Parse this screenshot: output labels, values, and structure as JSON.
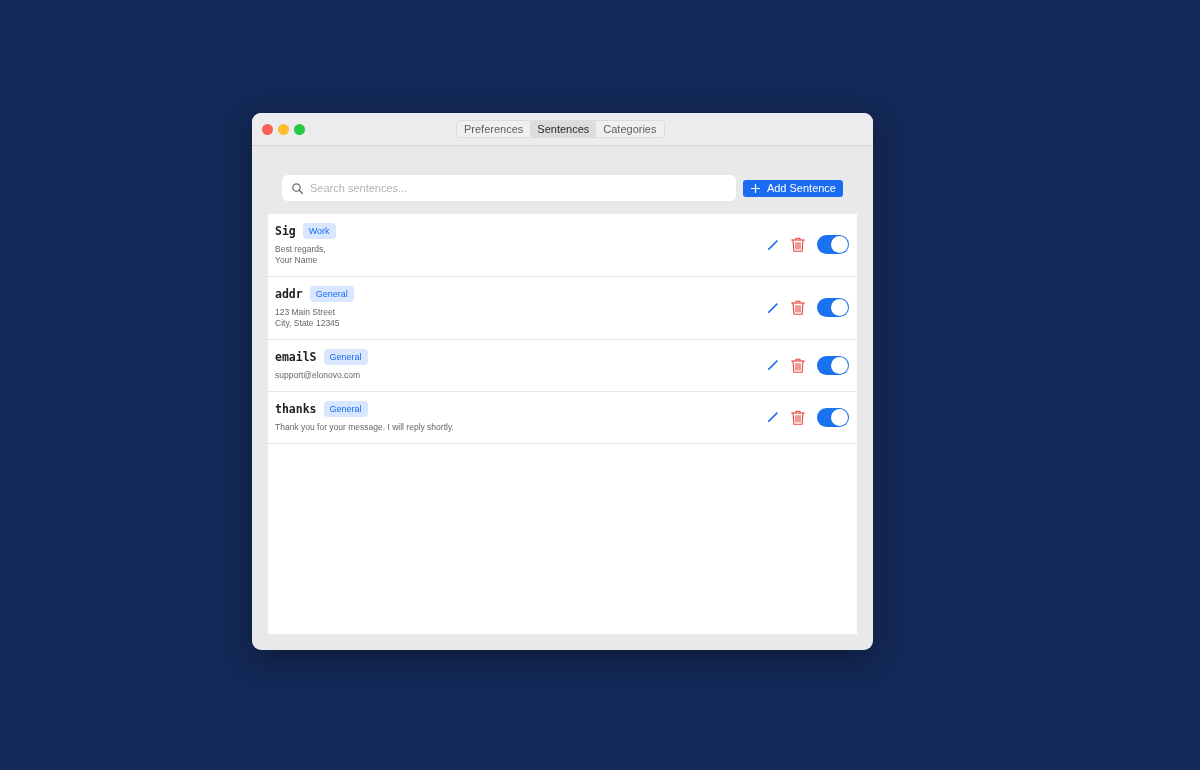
{
  "tabs": [
    {
      "label": "Preferences",
      "selected": false
    },
    {
      "label": "Sentences",
      "selected": true
    },
    {
      "label": "Categories",
      "selected": false
    }
  ],
  "search": {
    "placeholder": "Search sentences..."
  },
  "add_button": {
    "label": "Add Sentence"
  },
  "sentences": [
    {
      "shortcut": "Sig",
      "category": "Work",
      "text": "Best regards,\nYour Name",
      "enabled": true
    },
    {
      "shortcut": "addr",
      "category": "General",
      "text": "123 Main Street\nCity, State 12345",
      "enabled": true
    },
    {
      "shortcut": "emailS",
      "category": "General",
      "text": "support@elonovo.com",
      "enabled": true
    },
    {
      "shortcut": "thanks",
      "category": "General",
      "text": "Thank you for your message. I will reply shortly.",
      "enabled": true
    }
  ]
}
